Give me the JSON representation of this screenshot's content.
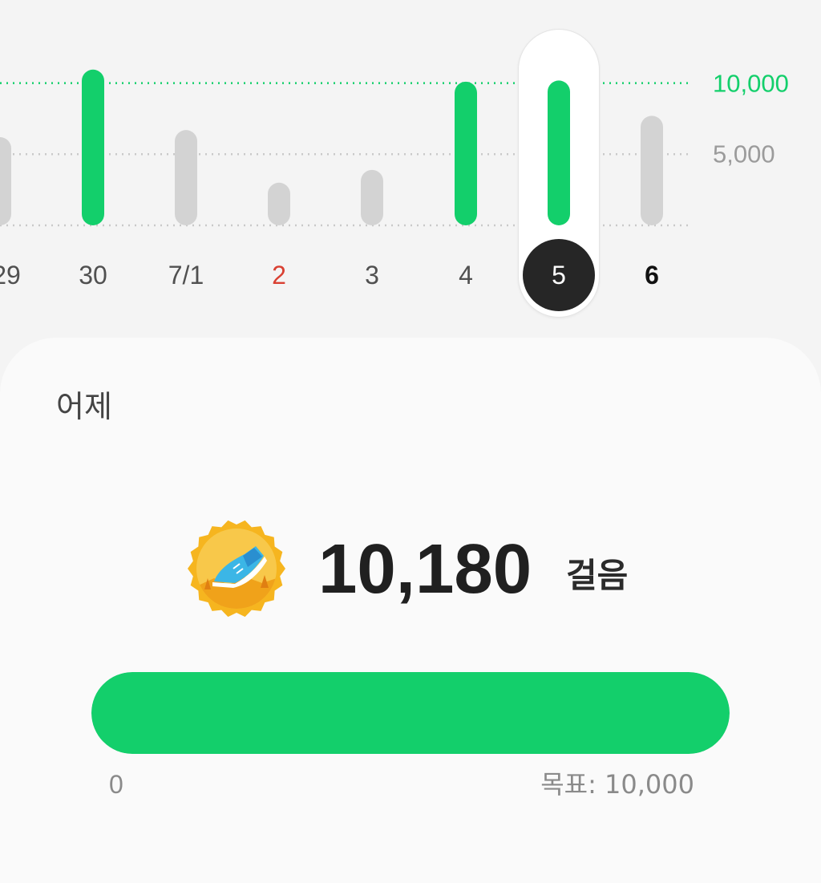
{
  "colors": {
    "goal_met": "#13cf6b",
    "goal_not_met": "#d3d3d3",
    "holiday_label": "#d94032",
    "today_label": "#111111",
    "selected_bg": "#262626",
    "selected_text": "#ffffff"
  },
  "chart_data": {
    "type": "bar",
    "categories": [
      "29",
      "30",
      "7/1",
      "2",
      "3",
      "4",
      "5",
      "6"
    ],
    "values": [
      6200,
      10950,
      6700,
      3000,
      3900,
      10100,
      10180,
      7700
    ],
    "goal_met": [
      false,
      true,
      false,
      false,
      false,
      true,
      true,
      false
    ],
    "category_style": [
      "normal",
      "normal",
      "normal",
      "holiday",
      "normal",
      "normal",
      "selected",
      "today"
    ],
    "selected_index": 6,
    "reference_lines": [
      {
        "value": 10000,
        "label": "10,000",
        "style": "goal"
      },
      {
        "value": 5000,
        "label": "5,000",
        "style": "normal"
      },
      {
        "value": 0,
        "label": "",
        "style": "baseline"
      }
    ],
    "ylim": [
      0,
      10950
    ],
    "grid": true
  },
  "detail": {
    "day_label": "어제",
    "medal_icon": "walking-shoe-medal-icon",
    "steps": "10,180",
    "unit": "걸음",
    "progress": {
      "min_label": "0",
      "goal_label": "목표: 10,000",
      "value": 10180,
      "goal": 10000
    }
  }
}
